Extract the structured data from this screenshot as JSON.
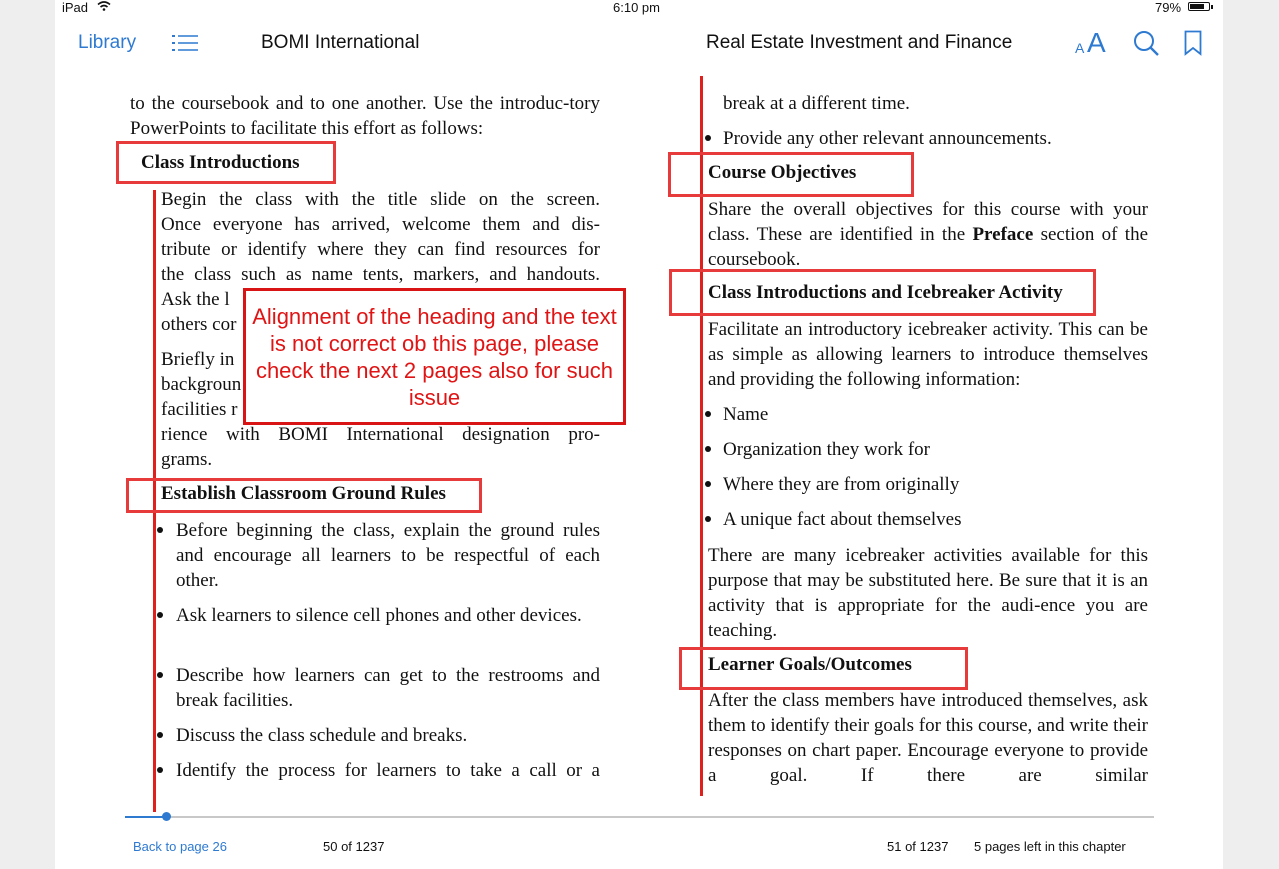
{
  "status_bar": {
    "device": "iPad",
    "time": "6:10 pm",
    "battery": "79%",
    "battery_level": 0.79
  },
  "toolbar": {
    "library_label": "Library",
    "left_title": "BOMI International",
    "right_title": "Real Estate Investment and Finance",
    "font_button_small": "A",
    "font_button_large": "A"
  },
  "left_page": {
    "intro": "to the coursebook and to one another. Use the introduc-tory PowerPoints to facilitate this effort as follows:",
    "heading1": "Class Introductions",
    "para1_lines": [
      "Begin the class with the title slide on the screen.",
      "Once everyone has arrived, welcome them and dis-",
      "tribute or identify where they can find resources for",
      "the class such as name tents, markers, and handouts.",
      "Ask the l",
      "others cor"
    ],
    "para2_lines": [
      "Briefly in",
      "backgroun",
      "facilities r",
      "rience with BOMI International designation pro-",
      "grams."
    ],
    "heading2": "Establish Classroom Ground Rules",
    "bullets": [
      "Before beginning the class, explain the ground rules and encourage all learners to be respectful of each other.",
      "Ask learners to silence cell phones and other devices.",
      "Describe how learners can get to the restrooms and break facilities.",
      "Discuss the class schedule and breaks.",
      "Identify the process for learners to take a call or a"
    ]
  },
  "right_page": {
    "continuation": "break at a different time.",
    "bullet_announce": "Provide any other relevant announcements.",
    "heading1": "Course Objectives",
    "para1_before": "Share the overall objectives for this course with your class. These are identified in the ",
    "para1_bold": "Preface",
    "para1_after": " section of the coursebook.",
    "heading2": "Class Introductions and Icebreaker Activity",
    "para2": "Facilitate an introductory icebreaker activity. This can be as simple as allowing learners to introduce themselves and providing the following information:",
    "info_bullets": [
      "Name",
      "Organization they work for",
      "Where they are from originally",
      "A unique fact about themselves"
    ],
    "para3": "There are many icebreaker activities available for this purpose that may be substituted here. Be sure that it is an activity that is appropriate for the audi-ence you are teaching.",
    "heading3": "Learner Goals/Outcomes",
    "para4": "After the class members have introduced themselves, ask them to identify their goals for this course, and write their responses on chart paper. Encourage everyone to provide a goal. If there are similar"
  },
  "annotation": {
    "callout_text": "Alignment of the heading and the text is not correct ob this page, please check the next 2 pages also for such issue",
    "color": "#e0201c"
  },
  "footer": {
    "back_link": "Back to page 26",
    "left_page_count": "50 of 1237",
    "right_page_count": "51 of 1237",
    "pages_left": "5 pages left in this chapter",
    "progress_fraction": 0.04
  },
  "colors": {
    "accent": "#2e7ad1",
    "annotation": "#e0201c"
  }
}
